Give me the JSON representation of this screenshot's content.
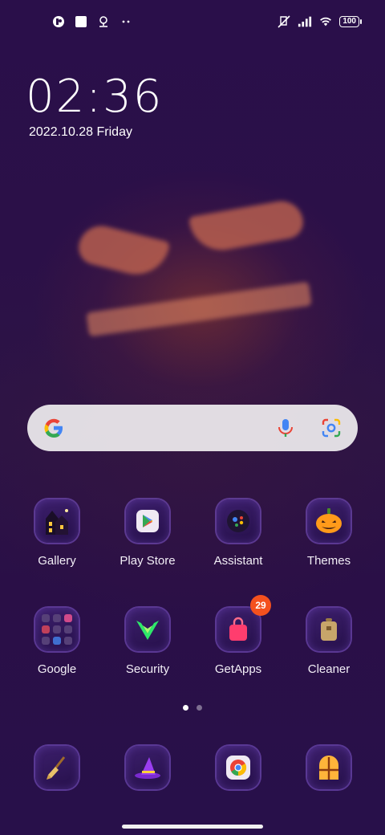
{
  "status_bar": {
    "battery": "100",
    "icons": [
      "app-notification-icon",
      "square-notification-icon",
      "location-pin-icon",
      "more-dots-icon",
      "mute-icon",
      "signal-icon",
      "wifi-icon",
      "battery-icon"
    ]
  },
  "clock": {
    "time": "02:36",
    "date": "2022.10.28 Friday"
  },
  "search": {
    "icons": [
      "google-logo-icon",
      "microphone-icon",
      "lens-camera-icon"
    ]
  },
  "apps_row1": [
    {
      "label": "Gallery",
      "icon": "haunted-house-icon"
    },
    {
      "label": "Play Store",
      "icon": "play-store-icon"
    },
    {
      "label": "Assistant",
      "icon": "assistant-icon"
    },
    {
      "label": "Themes",
      "icon": "pumpkin-icon"
    }
  ],
  "apps_row2": [
    {
      "label": "Google",
      "icon": "folder-grid-icon"
    },
    {
      "label": "Security",
      "icon": "security-shield-icon"
    },
    {
      "label": "GetApps",
      "icon": "shopping-bag-icon",
      "badge": "29"
    },
    {
      "label": "Cleaner",
      "icon": "trash-can-icon"
    }
  ],
  "dock": [
    {
      "icon": "broom-icon"
    },
    {
      "icon": "witch-hat-icon"
    },
    {
      "icon": "chrome-icon"
    },
    {
      "icon": "window-icon"
    }
  ],
  "colors": {
    "background": "#2a0f48",
    "badge": "#f4511e",
    "tile_border": "#8a5ad2"
  }
}
